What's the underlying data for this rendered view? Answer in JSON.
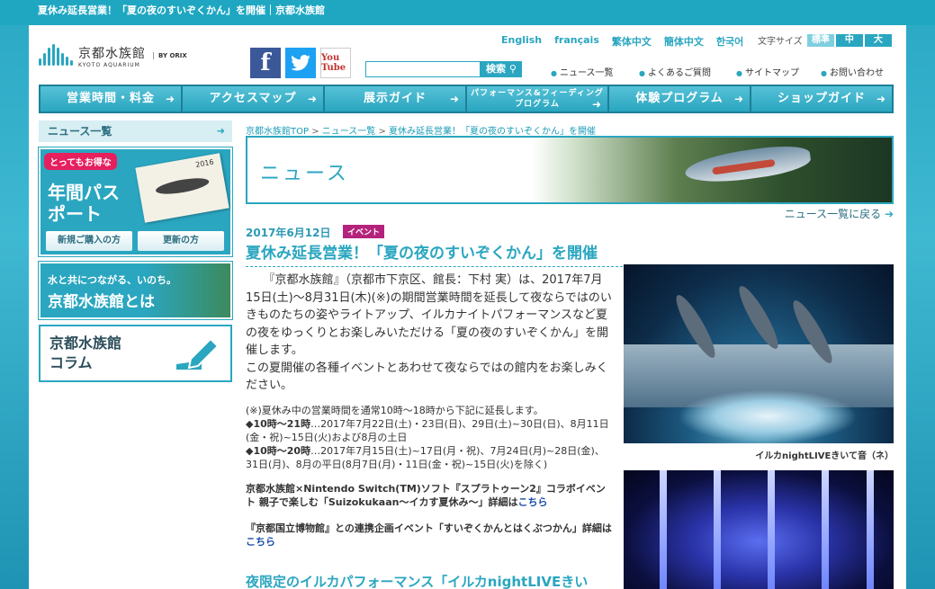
{
  "page_title": "夏休み延長営業！「夏の夜のすいぞくかん」を開催｜京都水族館",
  "languages": [
    "English",
    "français",
    "繁体中文",
    "簡体中文",
    "한국어"
  ],
  "font_size": {
    "label": "文字サイズ",
    "options": [
      "標準",
      "中",
      "大"
    ]
  },
  "logo": {
    "ja": "京都水族館",
    "en": "KYOTO AQUARIUM",
    "orix": "BY ORIX"
  },
  "social": {
    "facebook": "f",
    "youtube": "You Tube"
  },
  "search": {
    "placeholder": "",
    "button": "検索"
  },
  "utility_links": [
    "ニュース一覧",
    "よくあるご質問",
    "サイトマップ",
    "お問い合わせ"
  ],
  "nav": [
    "営業時間・料金",
    "アクセスマップ",
    "展示ガイド",
    "パフォーマンス&フィーディングプログラム",
    "体験プログラム",
    "ショップガイド"
  ],
  "sidebar": {
    "news_list": "ニュース一覧",
    "passport": {
      "ribbon": "とってもお得な",
      "title": "年間パスポート",
      "buy": "新規ご購入の方",
      "renew": "更新の方",
      "year": "2016"
    },
    "about": {
      "sub": "水と共につながる、いのち。",
      "title": "京都水族館とは"
    },
    "column": {
      "line1": "京都水族館",
      "line2": "コラム"
    }
  },
  "breadcrumb": [
    "京都水族館TOP",
    "ニュース一覧",
    "夏休み延長営業！「夏の夜のすいぞくかん」を開催"
  ],
  "hero_title": "ニュース",
  "back_link": "ニュース一覧に戻る",
  "article": {
    "date": "2017年6月12日",
    "tag": "イベント",
    "title": "夏休み延長営業！「夏の夜のすいぞくかん」を開催",
    "lead": "『京都水族館』（京都市下京区、館長：下村 実）は、2017年7月15日(土)～8月31日(木)(※)の期間営業時間を延長して夜ならではのいきものたちの姿やライトアップ、イルカナイトパフォーマンスなど夏の夜をゆっくりとお楽しみいただける「夏の夜のすいぞくかん」を開催します。",
    "lead2": "この夏開催の各種イベントとあわせて夜ならではの館内をお楽しみください。",
    "note_intro": "(※)夏休み中の営業時間を通常10時～18時から下記に延長します。",
    "note_21_label": "◆10時～21時",
    "note_21": "…2017年7月22日(土)・23日(日)、29日(土)~30日(日)、8月11日(金・祝)~15日(火)および8月の土日",
    "note_20_label": "◆10時～20時",
    "note_20": "…2017年7月15日(土)~17日(月・祝)、7月24日(月)~28日(金)、31日(月)、8月の平日(8月7日(月)・11日(金・祝)~15日(火)を除く)",
    "collab1": "京都水族館×Nintendo Switch(TM)ソフト『スプラトゥーン2』コラボイベント 親子で楽しむ「Suizokukaan～イカす夏休み～」詳細は",
    "collab2": "『京都国立博物館』との連携企画イベント「すいぞくかんとはくぶつかん」詳細は",
    "here": "こちら",
    "section2": "夜限定のイルカパフォーマンス「イルカnightLIVEきい",
    "photo1_caption": "イルカnightLIVEきいて音（ネ）"
  }
}
